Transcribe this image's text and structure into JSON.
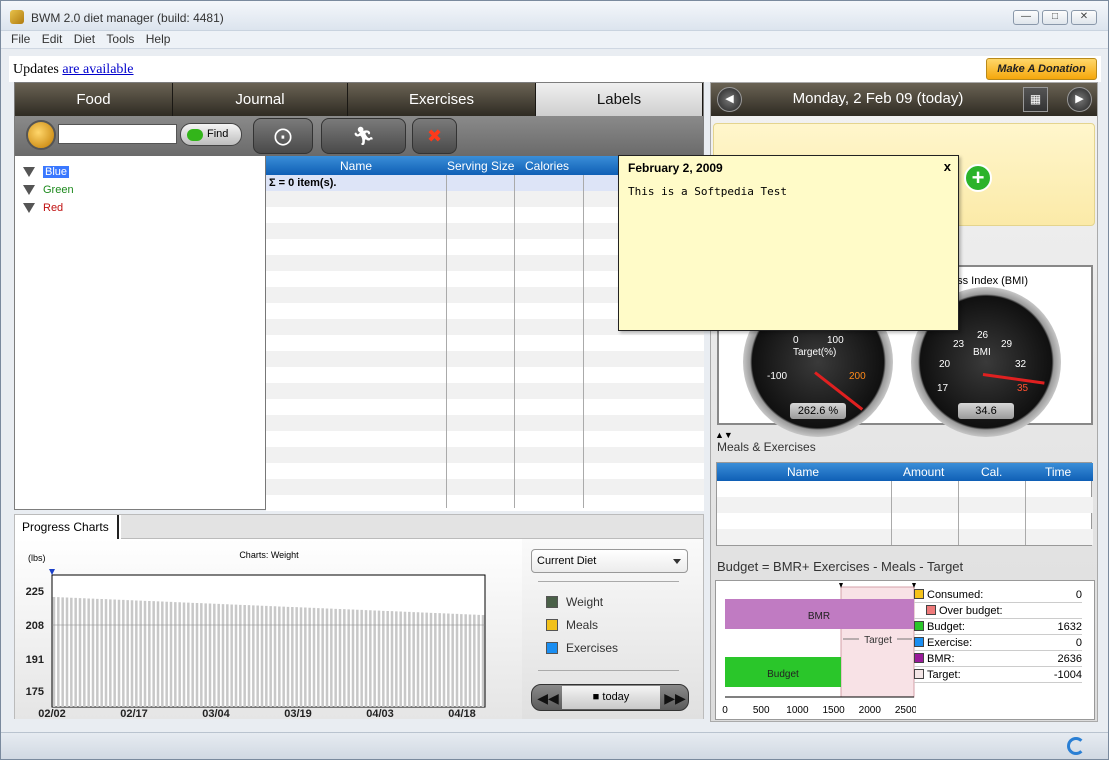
{
  "window": {
    "title": "BWM 2.0 diet manager (build: 4481)",
    "min": "—",
    "max": "□",
    "close": "✕"
  },
  "menu": [
    "File",
    "Edit",
    "Diet",
    "Tools",
    "Help"
  ],
  "updates": {
    "prefix": "Updates",
    "link": "are available"
  },
  "donate": "Make A Donation",
  "tabs": [
    {
      "label": "Food"
    },
    {
      "label": "Journal"
    },
    {
      "label": "Exercises"
    },
    {
      "label": "Labels"
    }
  ],
  "toolbar": {
    "search_value": "",
    "find": "Find"
  },
  "labels_tree": [
    {
      "name": "Blue",
      "color": "#1a3fc8"
    },
    {
      "name": "Green",
      "color": "#1e8a1e"
    },
    {
      "name": "Red",
      "color": "#c01010"
    }
  ],
  "grid": {
    "columns": [
      "Name",
      "Serving Size",
      "Calories"
    ],
    "summary": "Σ = 0 item(s)."
  },
  "progress": {
    "tab": "Progress Charts",
    "chart_title": "Charts: Weight",
    "dropdown": "Current Diet",
    "legend": [
      {
        "name": "Weight",
        "color": "#4a6048"
      },
      {
        "name": "Meals",
        "color": "#f2c11a"
      },
      {
        "name": "Exercises",
        "color": "#1a8ef2"
      }
    ],
    "today": "today"
  },
  "chart_data": {
    "type": "area",
    "ylabel": "(lbs)",
    "ylim": [
      167,
      233
    ],
    "yticks": [
      175,
      191,
      208,
      225
    ],
    "x_labels": [
      "02/02",
      "02/17",
      "03/04",
      "03/19",
      "04/03",
      "04/18"
    ],
    "series": [
      {
        "values": [
          222,
          213
        ]
      }
    ]
  },
  "date": {
    "label": "Monday, 2 Feb 09 (today)"
  },
  "gauges": {
    "bmi_title": "ass Index (BMI)",
    "target": {
      "label": "Target(%)",
      "ticks": [
        "0",
        "100",
        "200",
        "-100"
      ],
      "value": "262.6 %"
    },
    "bmi": {
      "label": "BMI",
      "ticks": [
        "23",
        "26",
        "29",
        "20",
        "32",
        "17",
        "35"
      ],
      "value": "34.6"
    }
  },
  "meals": {
    "title": "Meals & Exercises",
    "columns": [
      "Name",
      "Amount",
      "Cal.",
      "Time"
    ]
  },
  "budget": {
    "title": "Budget = BMR+ Exercises - Meals - Target",
    "bars": {
      "bmr": "BMR",
      "budget": "Budget",
      "target": "Target"
    },
    "axis": [
      "0",
      "500",
      "1000",
      "1500",
      "2000",
      "2500"
    ],
    "table": [
      {
        "label": "Consumed:",
        "value": "0",
        "color": "#f5c21a"
      },
      {
        "label": "Over budget:",
        "value": "",
        "color": "#ee7a7a"
      },
      {
        "label": "Budget:",
        "value": "1632",
        "color": "#2ac62a"
      },
      {
        "label": "Exercise:",
        "value": "0",
        "color": "#1a8ef2"
      },
      {
        "label": "BMR:",
        "value": "2636",
        "color": "#9a1a9a"
      },
      {
        "label": "Target:",
        "value": "-1004",
        "color": "#f4e6e6"
      }
    ]
  },
  "sticky": {
    "title": "February 2, 2009",
    "close": "x",
    "body": "This is a Softpedia Test"
  }
}
